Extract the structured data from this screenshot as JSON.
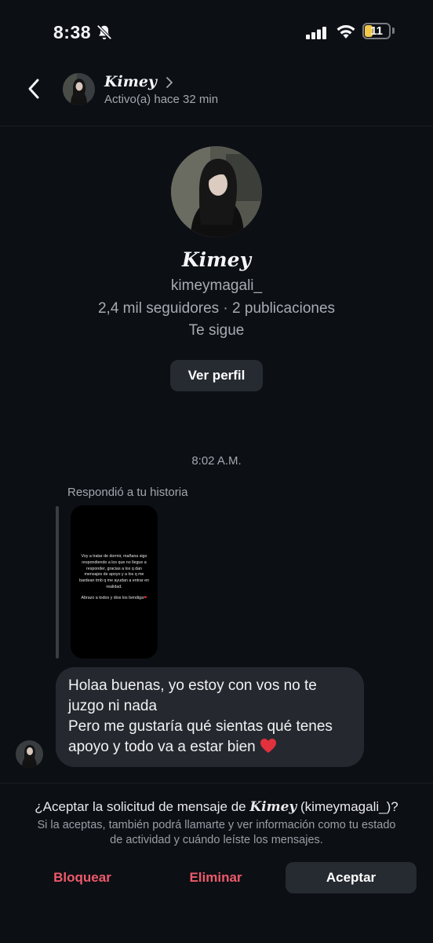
{
  "status_bar": {
    "time": "8:38",
    "battery": "11"
  },
  "header": {
    "name": "Kimey",
    "status": "Activo(a) hace 32 min"
  },
  "profile": {
    "name": "Kimey",
    "username": "kimeymagali_",
    "stats": "2,4 mil seguidores · 2 publicaciones",
    "follows": "Te sigue",
    "view_profile": "Ver perfil"
  },
  "conversation": {
    "timestamp": "8:02 A.M.",
    "replied_label": "Respondió a tu historia",
    "story_text": "Voy a tratar de dormir, mañana sigo respondiendo a los que no llegue a responder, gracias a los q dan mensajes de apoyo y a los q me bardean tmb q me ayudan a entrar en realidad.",
    "story_sign": "Abrazo a todos y dios los bendiga",
    "message_line1": "Holaa buenas, yo estoy con vos no te juzgo ni nada",
    "message_line2": "Pero me gustaría qué sientas qué tenes apoyo y todo va a estar bien"
  },
  "request": {
    "title_prefix": "¿Aceptar la solicitud de mensaje de",
    "title_name": "Kimey",
    "title_suffix": "(kimeymagali_)?",
    "description": "Si la aceptas, también podrá llamarte y ver información como tu estado de actividad y cuándo leíste los mensajes.",
    "block": "Bloquear",
    "delete": "Eliminar",
    "accept": "Aceptar"
  },
  "colors": {
    "background": "#0c0f14",
    "bubble": "#25292f",
    "danger": "#ee5a6b",
    "secondary_text": "#a4a7ae"
  },
  "icons": [
    "bell-slash-icon",
    "signal-icon",
    "wifi-icon",
    "battery-icon",
    "back-arrow-icon",
    "chevron-right-icon",
    "heart-icon"
  ]
}
